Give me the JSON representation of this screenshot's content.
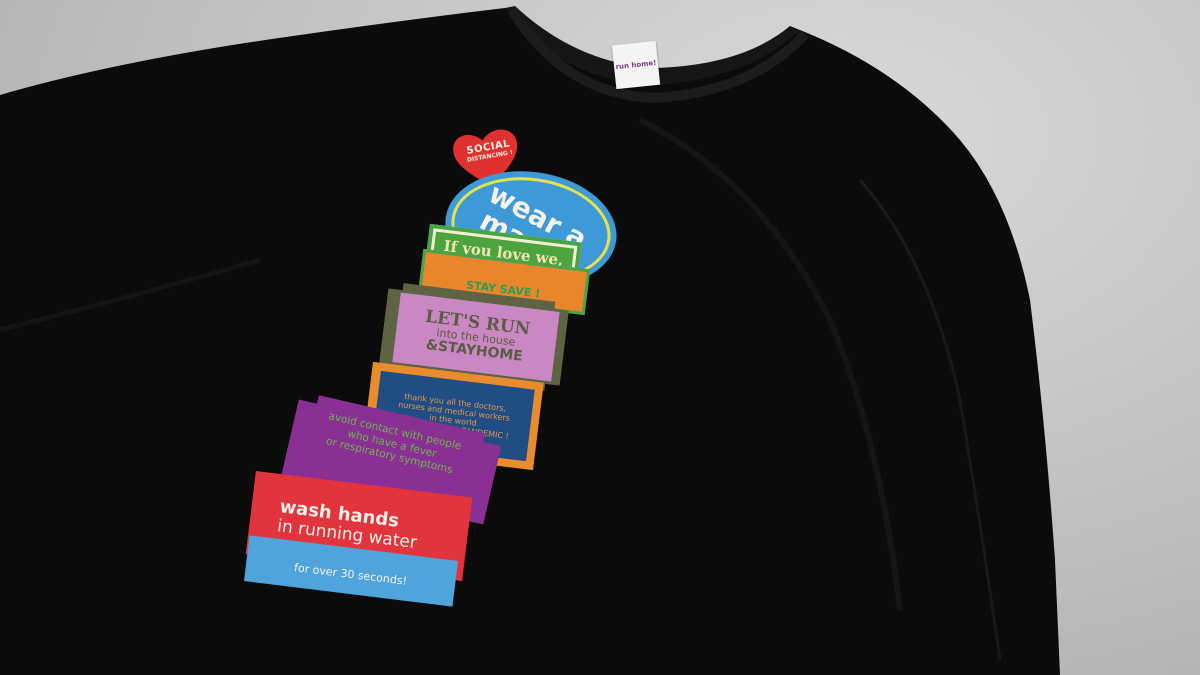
{
  "scene": {
    "description_colors": {
      "background": "#bdbdbb",
      "shirt": "#0a0a0a"
    },
    "shirt_tag_text": "run home!"
  },
  "stickers": {
    "heart": {
      "line1": "SOCIAL",
      "line2": "DISTANCING !",
      "color": "#e0302f"
    },
    "mask": {
      "text": "wear a mask!",
      "color": "#3d9ad7"
    },
    "love": {
      "text": "If you love we,",
      "color": "#4da43e"
    },
    "save": {
      "text": "STAY SAVE !",
      "color": "#e9852a"
    },
    "run": {
      "line1": "LET'S RUN",
      "line2": "into the house",
      "line3": "&STAYHOME",
      "color": "#c987c4"
    },
    "thanks": {
      "lines": [
        "thank you all the doctors,",
        "nurses and medical workers",
        "in the world",
        "during the 2021 PANDEMIC !"
      ],
      "color": "#1f4d84"
    },
    "avoid": {
      "lines": [
        "avoid contact with people",
        "who have a fever",
        "or respiratory symptoms"
      ],
      "color": "#8a2f93"
    },
    "wash": {
      "line1": "wash hands",
      "line2": "in running water",
      "color": "#e2343d"
    },
    "seconds": {
      "text": "for over 30 seconds!",
      "color": "#4fa5db"
    }
  }
}
